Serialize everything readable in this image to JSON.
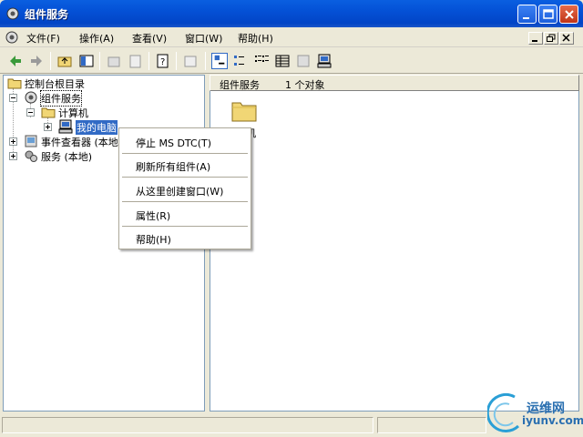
{
  "window": {
    "title": "组件服务"
  },
  "menu": {
    "file": "文件(F)",
    "action": "操作(A)",
    "view": "查看(V)",
    "window": "窗口(W)",
    "help": "帮助(H)"
  },
  "tree": {
    "root": "控制台根目录",
    "component_services": "组件服务",
    "computers": "计算机",
    "my_computer": "我的电脑",
    "event_viewer": "事件查看器 (本地)",
    "services": "服务 (本地)"
  },
  "right_header": {
    "title": "组件服务",
    "count": "1 个对象"
  },
  "right_pane": {
    "item_label": "计算机"
  },
  "context_menu": {
    "items": [
      "停止 MS DTC(T)",
      "刷新所有组件(A)",
      "从这里创建窗口(W)",
      "属性(R)",
      "帮助(H)"
    ]
  },
  "watermark": {
    "cn": "运维网",
    "url": "iyunv.com"
  },
  "colors": {
    "titlebar": "#0451d6",
    "selection": "#316ac5",
    "folder": "#f1d675"
  }
}
